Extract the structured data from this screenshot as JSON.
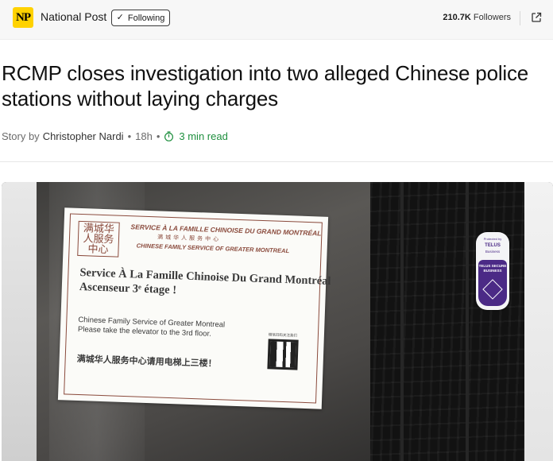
{
  "publisher": {
    "logo_text": "NP",
    "name": "National Post",
    "follow_label": "Following",
    "followers_count": "210.7K",
    "followers_label": "Followers"
  },
  "article": {
    "headline": "RCMP closes investigation into two alleged Chinese police stations without laying charges",
    "byline_prefix": "Story by",
    "author": "Christopher Nardi",
    "age": "18h",
    "read_time": "3 min read"
  },
  "image": {
    "sign": {
      "chop_text": "满城华人服务中心",
      "header_fr": "SERVICE À LA FAMILLE CHINOISE DU GRAND MONTRÉAL",
      "header_cn": "满城华人服务中心",
      "header_en": "CHINESE FAMILY SERVICE OF GREATER MONTREAL",
      "title_line1": "Service À La Famille Chinoise Du Grand Montréal",
      "title_line2": "Ascenseur 3ᵉ étage !",
      "body_line1": "Chinese Family Service of Greater Montreal",
      "body_line2": "Please take the elevator to the 3rd floor.",
      "body_cn": "满城华人服务中心请用电梯上三楼！",
      "qr_caption": "微信扫码关注我们"
    },
    "sticker": {
      "top": "Protected by",
      "brand": "TELUS",
      "sub": "Business",
      "secure_line1": "TELUS SECURE",
      "secure_line2": "BUSINESS"
    }
  },
  "colors": {
    "logo_yellow": "#ffd200",
    "read_time_green": "#1e8f3e",
    "sign_accent": "#8a4a3c",
    "telus_purple": "#4b2a86"
  },
  "icons": {
    "follow": "check-icon",
    "open": "external-link-icon",
    "read_time": "timer-icon"
  }
}
